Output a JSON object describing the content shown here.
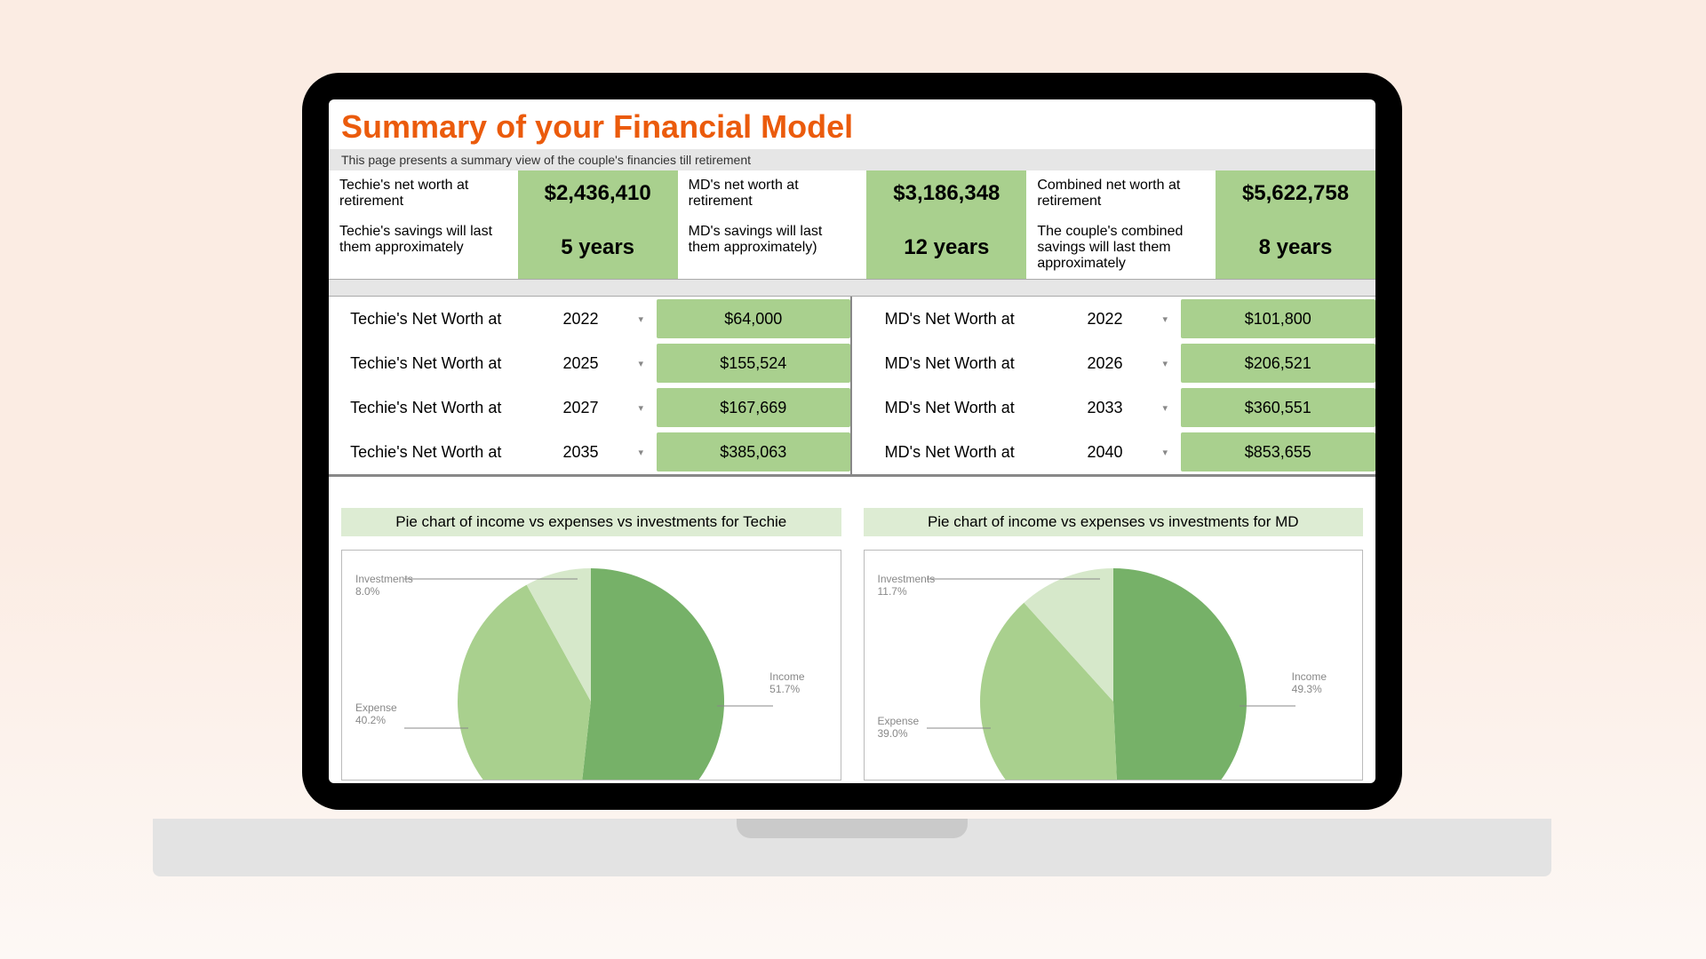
{
  "header": {
    "title": "Summary of your Financial Model",
    "subtitle": "This page presents a summary view of the couple's financies till retirement"
  },
  "kpis": [
    {
      "label": "Techie's net worth at retirement",
      "value": "$2,436,410"
    },
    {
      "label": "MD's net worth at retirement",
      "value": "$3,186,348"
    },
    {
      "label": "Combined net worth at retirement",
      "value": "$5,622,758"
    },
    {
      "label": "Techie's savings will last them approximately",
      "value": "5 years"
    },
    {
      "label": "MD's savings will last them approximately)",
      "value": "12 years"
    },
    {
      "label": "The couple's combined savings will last them approximately",
      "value": "8 years"
    }
  ],
  "networth": {
    "left_label": "Techie's Net Worth at",
    "right_label": "MD's Net Worth at",
    "left": [
      {
        "year": "2022",
        "value": "$64,000"
      },
      {
        "year": "2025",
        "value": "$155,524"
      },
      {
        "year": "2027",
        "value": "$167,669"
      },
      {
        "year": "2035",
        "value": "$385,063"
      }
    ],
    "right": [
      {
        "year": "2022",
        "value": "$101,800"
      },
      {
        "year": "2026",
        "value": "$206,521"
      },
      {
        "year": "2033",
        "value": "$360,551"
      },
      {
        "year": "2040",
        "value": "$853,655"
      }
    ]
  },
  "pies": {
    "left_title": "Pie chart of income vs expenses vs investments for Techie",
    "right_title": "Pie chart of income vs expenses vs investments for MD",
    "left_callouts": {
      "investments": "Investments",
      "investments_pct": "8.0%",
      "expense": "Expense",
      "expense_pct": "40.2%",
      "income": "Income",
      "income_pct": "51.7%"
    },
    "right_callouts": {
      "investments": "Investments",
      "investments_pct": "11.7%",
      "expense": "Expense",
      "expense_pct": "39.0%",
      "income": "Income",
      "income_pct": "49.3%"
    }
  },
  "chart_data": [
    {
      "type": "pie",
      "title": "Pie chart of income vs expenses vs investments for Techie",
      "series": [
        {
          "name": "Income",
          "value": 51.7,
          "color": "#76B168"
        },
        {
          "name": "Expense",
          "value": 40.2,
          "color": "#A9D08E"
        },
        {
          "name": "Investments",
          "value": 8.0,
          "color": "#D6E8CA"
        }
      ],
      "unit": "percent"
    },
    {
      "type": "pie",
      "title": "Pie chart of income vs expenses vs investments for MD",
      "series": [
        {
          "name": "Income",
          "value": 49.3,
          "color": "#76B168"
        },
        {
          "name": "Expense",
          "value": 39.0,
          "color": "#A9D08E"
        },
        {
          "name": "Investments",
          "value": 11.7,
          "color": "#D6E8CA"
        }
      ],
      "unit": "percent"
    }
  ]
}
